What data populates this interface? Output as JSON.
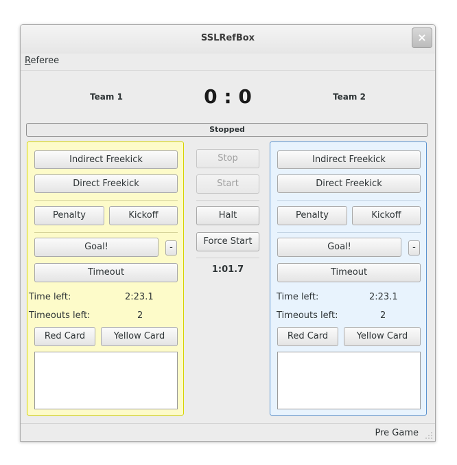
{
  "window": {
    "title": "SSLRefBox",
    "close_glyph": "×"
  },
  "menu": {
    "items": [
      {
        "label": "Referee",
        "accel": "R",
        "rest": "eferee"
      }
    ]
  },
  "scoreboard": {
    "team1": "Team 1",
    "team2": "Team 2",
    "score": "0 : 0",
    "state": "Stopped"
  },
  "team_left": {
    "color": "#fdfbc9",
    "indirect": "Indirect Freekick",
    "direct": "Direct Freekick",
    "penalty": "Penalty",
    "kickoff": "Kickoff",
    "goal": "Goal!",
    "minus": "-",
    "timeout": "Timeout",
    "time_left_label": "Time left:",
    "time_left": "2:23.1",
    "timeouts_left_label": "Timeouts left:",
    "timeouts_left": "2",
    "red_card": "Red Card",
    "yellow_card": "Yellow Card"
  },
  "team_right": {
    "color": "#e8f3fd",
    "indirect": "Indirect Freekick",
    "direct": "Direct Freekick",
    "penalty": "Penalty",
    "kickoff": "Kickoff",
    "goal": "Goal!",
    "minus": "-",
    "timeout": "Timeout",
    "time_left_label": "Time left:",
    "time_left": "2:23.1",
    "timeouts_left_label": "Timeouts left:",
    "timeouts_left": "2",
    "red_card": "Red Card",
    "yellow_card": "Yellow Card"
  },
  "center": {
    "stop": "Stop",
    "start": "Start",
    "halt": "Halt",
    "force_start": "Force Start",
    "game_clock": "1:01.7"
  },
  "statusbar": {
    "text": "Pre Game"
  }
}
